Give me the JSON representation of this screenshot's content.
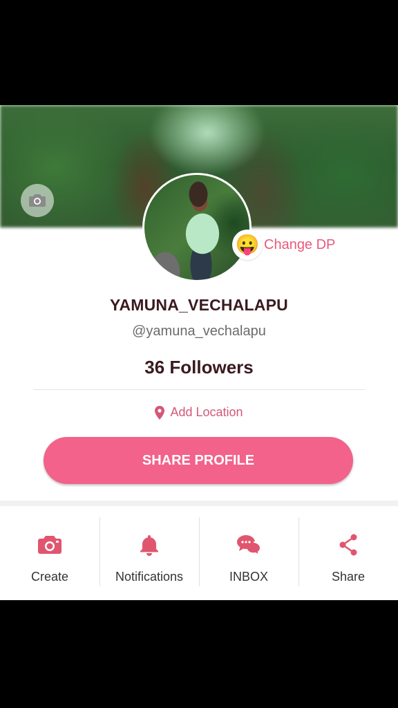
{
  "profile": {
    "username": "YAMUNA_VECHALAPU",
    "handle": "@yamuna_vechalapu",
    "followers": "36 Followers",
    "change_dp_label": "Change DP",
    "change_dp_emoji": "😛",
    "location_label": "Add Location",
    "share_profile_label": "SHARE PROFILE"
  },
  "actions": [
    {
      "label": "Create",
      "icon": "camera-icon"
    },
    {
      "label": "Notifications",
      "icon": "bell-icon"
    },
    {
      "label": "INBOX",
      "icon": "chat-bubbles-icon"
    },
    {
      "label": "Share",
      "icon": "share-icon"
    }
  ],
  "colors": {
    "accent": "#f2628a",
    "icon_pink": "#e0566f",
    "title_text": "#3a1a20"
  }
}
